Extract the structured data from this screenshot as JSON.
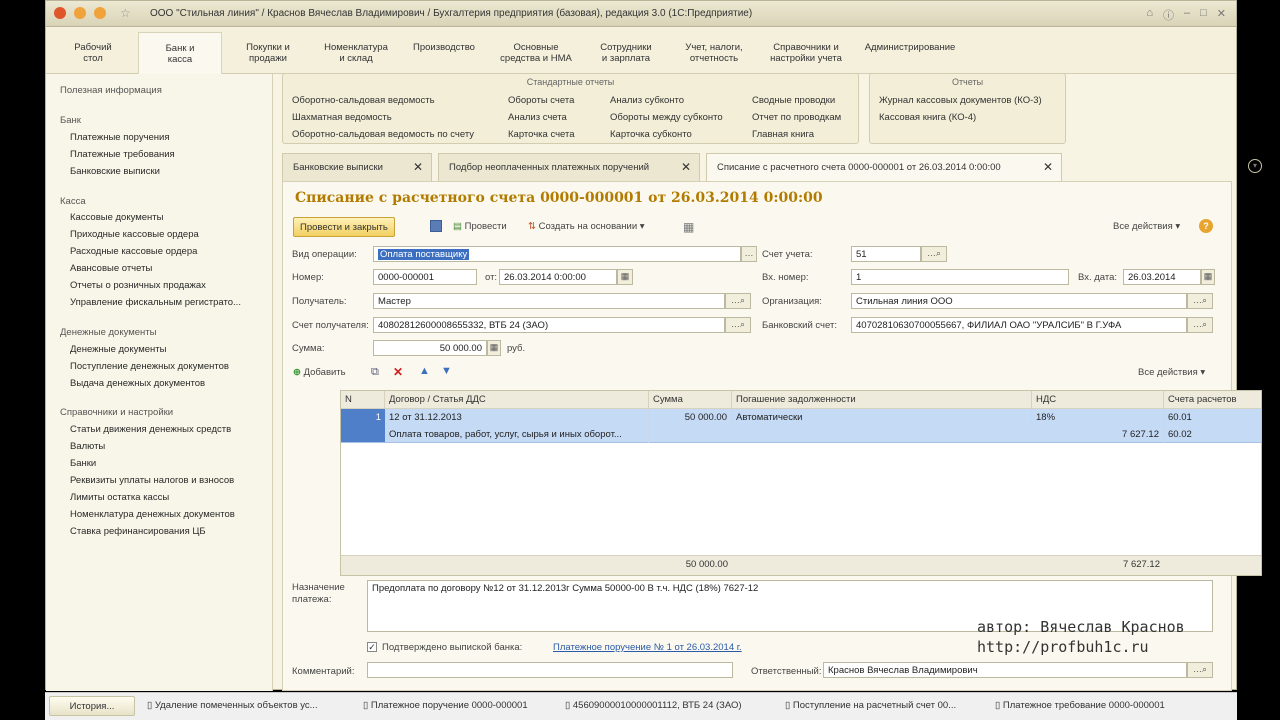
{
  "window": {
    "title": "ООО \"Стильная линия\" / Краснов Вячеслав Владимирович / Бухгалтерия предприятия (базовая), редакция 3.0  (1С:Предприятие)"
  },
  "sections": [
    {
      "label": "Рабочий\nстол"
    },
    {
      "label": "Банк и\nкасса"
    },
    {
      "label": "Покупки и\nпродажи"
    },
    {
      "label": "Номенклатура\nи склад"
    },
    {
      "label": "Производство"
    },
    {
      "label": "Основные\nсредства и НМА"
    },
    {
      "label": "Сотрудники\nи зарплата"
    },
    {
      "label": "Учет, налоги,\nотчетность"
    },
    {
      "label": "Справочники и\nнастройки учета"
    },
    {
      "label": "Администрирование"
    }
  ],
  "sidebar": {
    "useful": "Полезная информация",
    "bank_head": "Банк",
    "bank": [
      "Платежные поручения",
      "Платежные требования",
      "Банковские выписки"
    ],
    "cash_head": "Касса",
    "cash": [
      "Кассовые документы",
      "Приходные кассовые ордера",
      "Расходные кассовые ордера",
      "Авансовые отчеты",
      "Отчеты о розничных продажах",
      "Управление фискальным регистрато..."
    ],
    "money_head": "Денежные документы",
    "money": [
      "Денежные документы",
      "Поступление денежных документов",
      "Выдача денежных документов"
    ],
    "ref_head": "Справочники и настройки",
    "ref": [
      "Статьи движения денежных средств",
      "Валюты",
      "Банки",
      "Реквизиты уплаты налогов и взносов",
      "Лимиты остатка кассы",
      "Номенклатура денежных документов",
      "Ставка рефинансирования ЦБ"
    ]
  },
  "std_reports": {
    "title": "Стандартные отчеты",
    "col1": [
      "Оборотно-сальдовая ведомость",
      "Шахматная ведомость",
      "Оборотно-сальдовая ведомость по счету"
    ],
    "col2": [
      "Обороты счета",
      "Анализ счета",
      "Карточка счета"
    ],
    "col3": [
      "Анализ субконто",
      "Обороты между субконто",
      "Карточка субконто"
    ],
    "col4": [
      "Сводные проводки",
      "Отчет по проводкам",
      "Главная книга"
    ]
  },
  "reports": {
    "title": "Отчеты",
    "items": [
      "Журнал кассовых документов (КО-3)",
      "Кассовая книга (КО-4)"
    ]
  },
  "tabs": [
    {
      "label": "Банковские выписки"
    },
    {
      "label": "Подбор неоплаченных платежных поручений"
    },
    {
      "label": "Списание с расчетного счета 0000-000001 от 26.03.2014 0:00:00"
    }
  ],
  "form": {
    "title": "Списание с расчетного счета 0000-000001 от 26.03.2014 0:00:00",
    "btn_post_close": "Провести и закрыть",
    "btn_post": "Провести",
    "btn_create_based": "Создать на основании",
    "all_actions": "Все действия",
    "op_label": "Вид операции:",
    "op_value": "Оплата поставщику",
    "account_label": "Счет учета:",
    "account_value": "51",
    "number_label": "Номер:",
    "number_value": "0000-000001",
    "from_label": "от:",
    "date_value": "26.03.2014  0:00:00",
    "in_number_label": "Вх. номер:",
    "in_number_value": "1",
    "in_date_label": "Вх. дата:",
    "in_date_value": "26.03.2014",
    "recipient_label": "Получатель:",
    "recipient_value": "Мастер",
    "org_label": "Организация:",
    "org_value": "Стильная линия ООО",
    "recipient_acc_label": "Счет получателя:",
    "recipient_acc_value": "40802812600008655332, ВТБ 24 (ЗАО)",
    "bank_acc_label": "Банковский счет:",
    "bank_acc_value": "40702810630700055667, ФИЛИАЛ ОАО \"УРАЛСИБ\" В Г.УФА",
    "sum_label": "Сумма:",
    "sum_value": "50 000.00",
    "currency": "руб.",
    "add_btn": "Добавить",
    "all_actions2": "Все действия",
    "purpose_label": "Назначение\nплатежа:",
    "purpose_value": "Предоплата по договору №12 от 31.12.2013г  Сумма 50000-00 В т.ч. НДС  (18%) 7627-12",
    "confirmed_label": "Подтверждено выпиской банка:",
    "payment_link": "Платежное поручение № 1 от 26.03.2014 г.",
    "comment_label": "Комментарий:",
    "responsible_label": "Ответственный:",
    "responsible_value": "Краснов Вячеслав Владимирович"
  },
  "grid": {
    "headers": [
      "N",
      "Договор / Статья ДДС",
      "Сумма",
      "Погашение задолженности",
      "НДС",
      "Счета расчетов"
    ],
    "row": {
      "n": "1",
      "contract": "12 от 31.12.2013",
      "article": "Оплата товаров, работ, услуг, сырья и иных оборот...",
      "sum": "50 000.00",
      "repayment": "Автоматически",
      "vat_rate": "18%",
      "vat_sum": "7 627.12",
      "acc1": "60.01",
      "acc2": "60.02"
    },
    "total_sum": "50 000.00",
    "total_vat": "7 627.12"
  },
  "watermark": {
    "author": "автор: Вячеслав Краснов",
    "site": "http://profbuh1c.ru"
  },
  "taskbar": {
    "history": "История...",
    "items": [
      "Удаление помеченных объектов ус...",
      "Платежное поручение 0000-000001",
      "45609000010000001112, ВТБ 24 (ЗАО)",
      "Поступление на расчетный счет 00...",
      "Платежное требование 0000-000001"
    ]
  },
  "colors": {
    "accent": "#b27b00",
    "selection": "#3c6fc0",
    "row": "#c5daf5"
  }
}
